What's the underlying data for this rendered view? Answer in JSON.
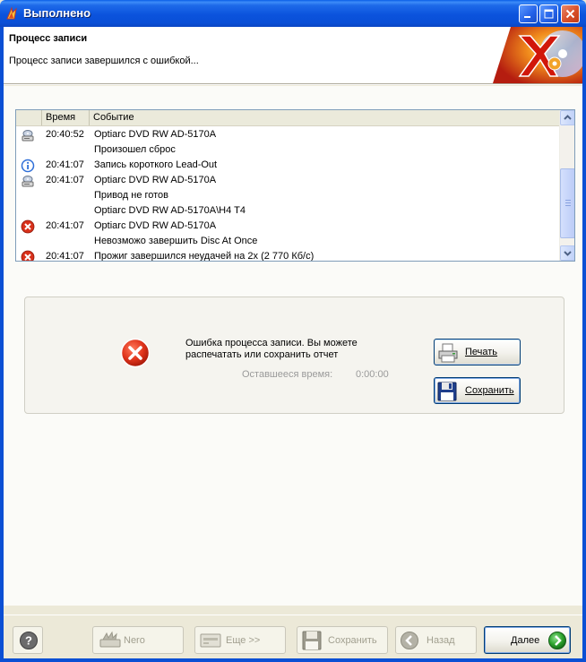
{
  "window": {
    "title": "Выполнено",
    "icon": "nero-flame-icon"
  },
  "header": {
    "title": "Процесс записи",
    "subtitle": "Процесс записи завершился с ошибкой..."
  },
  "log": {
    "columns": {
      "time": "Время",
      "event": "Событие"
    },
    "rows": [
      {
        "icon": "drive-icon",
        "time": "20:40:52",
        "event": "Optiarc  DVD RW AD-5170A"
      },
      {
        "icon": "",
        "time": "",
        "event": "Произошел сброс"
      },
      {
        "icon": "info-icon",
        "time": "20:41:07",
        "event": "Запись короткого Lead-Out"
      },
      {
        "icon": "drive-icon",
        "time": "20:41:07",
        "event": "Optiarc  DVD RW AD-5170A"
      },
      {
        "icon": "",
        "time": "",
        "event": "Привод не готов"
      },
      {
        "icon": "",
        "time": "",
        "event": "Optiarc DVD RW AD-5170A\\H4 T4"
      },
      {
        "icon": "error-icon",
        "time": "20:41:07",
        "event": "Optiarc  DVD RW AD-5170A"
      },
      {
        "icon": "",
        "time": "",
        "event": "Невозможо завершить Disc At Once"
      },
      {
        "icon": "error-icon",
        "time": "20:41:07",
        "event": "Прожиг завершился неудачей на 2x (2 770 Кб/с)"
      }
    ]
  },
  "status": {
    "message": "Ошибка процесса записи. Вы можете распечатать или сохранить отчет",
    "remaining_label": "Оставшееся время:",
    "remaining_value": "0:00:00",
    "print_label": "Печать",
    "save_label": "Сохранить"
  },
  "footer": {
    "nero_label": "Nero",
    "more_label": "Еще >>",
    "save_label": "Сохранить",
    "back_label": "Назад",
    "next_label": "Далее"
  },
  "colors": {
    "titlebar": "#0b53dd",
    "error_red": "#d8301a",
    "info_blue": "#2f6fd8",
    "next_green": "#2fa52f"
  }
}
